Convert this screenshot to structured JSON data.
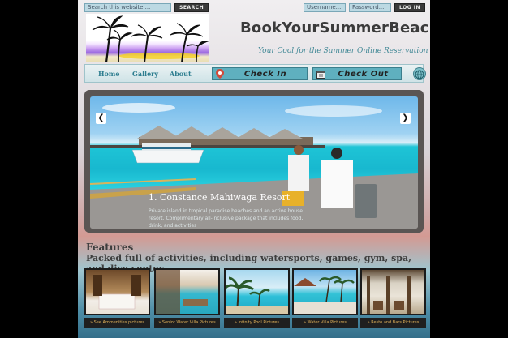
{
  "search": {
    "placeholder": "Search this website ...",
    "button_label": "SEARCH"
  },
  "login": {
    "username_placeholder": "Username...",
    "password_placeholder": "Password...",
    "button_label": "LOG IN"
  },
  "site": {
    "title": "BookYourSummerBeach",
    "tagline": "Your Cool for the Summer Online Reservation"
  },
  "nav": {
    "links": [
      "Home",
      "Gallery",
      "About"
    ],
    "check_in_label": "Check In",
    "check_out_label": "Check Out"
  },
  "slider": {
    "prev": "❮",
    "next": "❯",
    "caption_title": "1. Constance Mahiwaga Resort",
    "caption_desc": "Private island in tropical paradise beaches and an active house resort. Complimentary all-inclusive package that includes food, drink, and activities"
  },
  "features": {
    "title": "Features",
    "subtitle": "Packed full of activities, including watersports, games, gym, spa, and dive center",
    "cards": [
      {
        "label": "» See Ammenities pictures"
      },
      {
        "label": "» Senior Water Villa Pictures"
      },
      {
        "label": "» Infinity Pool Pictures"
      },
      {
        "label": "» Water Villa Pictures"
      },
      {
        "label": "» Resto and Bars Pictures"
      }
    ]
  },
  "colors": {
    "accent": "#2d7d8f",
    "nav_button": "#5fb0bf",
    "label_text": "#e3b35a"
  }
}
